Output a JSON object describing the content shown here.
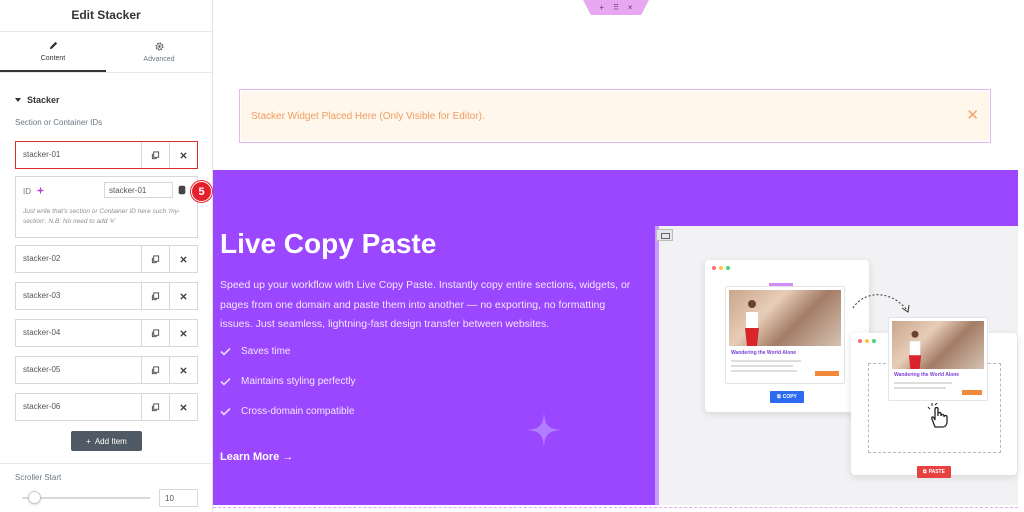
{
  "sidebar": {
    "title": "Edit Stacker",
    "tabs": [
      {
        "label": "Content",
        "icon": "pencil-icon",
        "active": true
      },
      {
        "label": "Advanced",
        "icon": "gear-icon",
        "active": false
      }
    ],
    "section": "Stacker",
    "ids_label": "Section or Container IDs",
    "items": [
      "stacker-01",
      "stacker-02",
      "stacker-03",
      "stacker-04",
      "stacker-05",
      "stacker-06"
    ],
    "selected_index": 0,
    "id_field": {
      "label": "ID",
      "value": "stacker-01",
      "help": "Just write that's section or Container ID here such 'my-section'. N.B: No need to add '#'"
    },
    "step_badge": "5",
    "add_item_label": "Add Item",
    "scroller_start": {
      "label": "Scroller Start",
      "value": "10",
      "fraction": 0.05
    }
  },
  "canvas": {
    "notice": "Stacker Widget Placed Here (Only Visible for Editor).",
    "hero": {
      "title": "Live Copy Paste",
      "description": "Speed up your workflow with Live Copy Paste. Instantly copy entire sections, widgets, or pages from one domain and paste them into another — no exporting, no formatting issues. Just seamless, lightning-fast design transfer between websites.",
      "features": [
        "Saves time",
        "Maintains styling perfectly",
        "Cross-domain compatible"
      ],
      "cta": "Learn More →",
      "illustration": {
        "card_title_1": "Wandering the World Alone",
        "card_title_2": "Wandering the World Alone",
        "copy_label": "COPY",
        "paste_label": "PASTE"
      }
    }
  },
  "colors": {
    "hero_bg": "#9b46ff",
    "notice_bg": "#fff6ec",
    "notice_text": "#ef9d62",
    "badge": "#e5202e",
    "selected_border": "#d93025"
  }
}
